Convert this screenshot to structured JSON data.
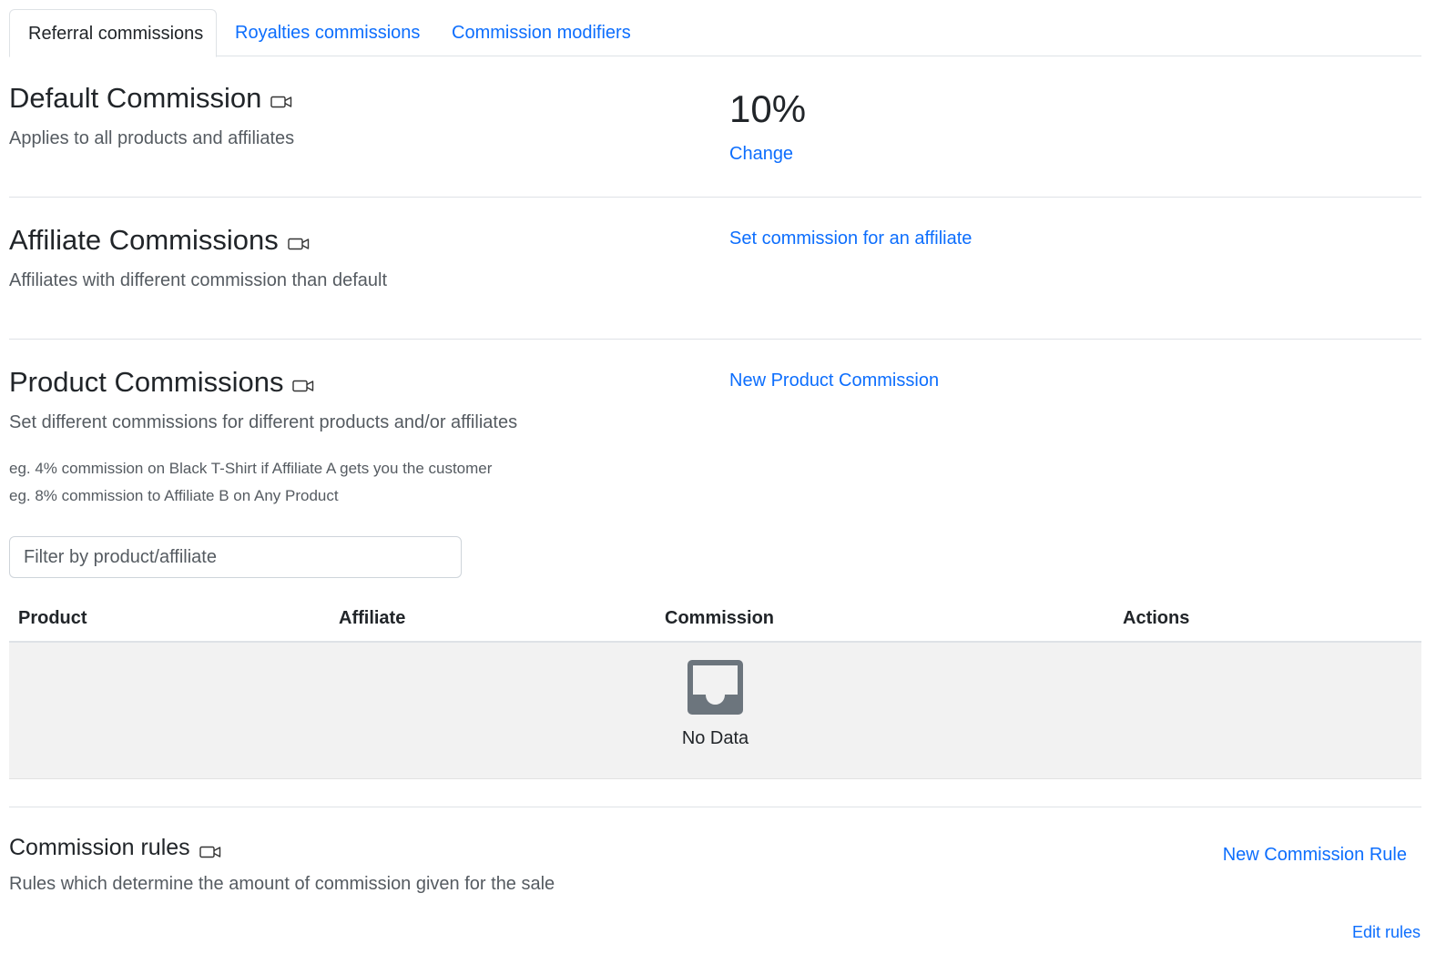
{
  "tabs": [
    {
      "label": "Referral commissions",
      "active": true
    },
    {
      "label": "Royalties commissions",
      "active": false
    },
    {
      "label": "Commission modifiers",
      "active": false
    }
  ],
  "default_commission": {
    "title": "Default Commission",
    "subtitle": "Applies to all products and affiliates",
    "value": "10%",
    "change_label": "Change"
  },
  "affiliate_commissions": {
    "title": "Affiliate Commissions",
    "subtitle": "Affiliates with different commission than default",
    "action_label": "Set commission for an affiliate"
  },
  "product_commissions": {
    "title": "Product Commissions",
    "subtitle": "Set different commissions for different products and/or affiliates",
    "example1": "eg. 4% commission on Black T-Shirt if Affiliate A gets you the customer",
    "example2": "eg. 8% commission to Affiliate B on Any Product",
    "action_label": "New Product Commission",
    "filter_placeholder": "Filter by product/affiliate",
    "table": {
      "columns": [
        "Product",
        "Affiliate",
        "Commission",
        "Actions"
      ],
      "rows": [],
      "empty_text": "No Data"
    }
  },
  "commission_rules": {
    "title": "Commission rules",
    "subtitle": "Rules which determine the amount of commission given for the sale",
    "action_label": "New Commission Rule",
    "edit_label": "Edit rules"
  },
  "colors": {
    "link": "#0d6efd",
    "text": "#212529",
    "muted": "#555b61",
    "border": "#dee2e6",
    "empty_bg": "#f2f2f2",
    "empty_icon": "#6c757d"
  },
  "icons": {
    "section_title_icon": "video-camera-icon",
    "empty_state_icon": "inbox-icon"
  }
}
